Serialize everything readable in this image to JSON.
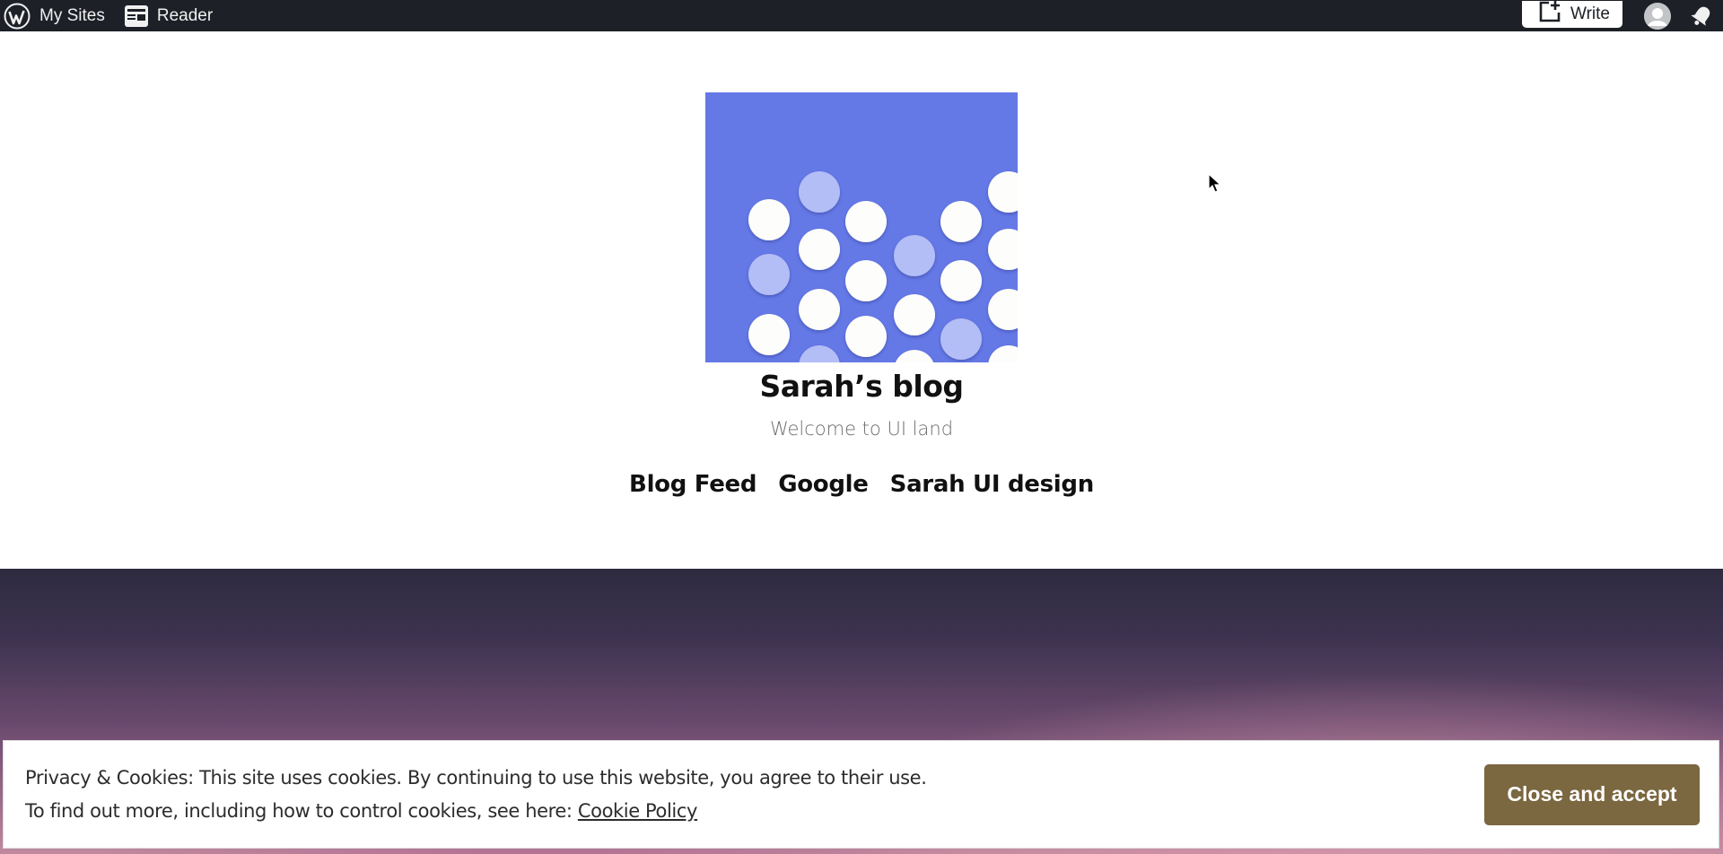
{
  "adminbar": {
    "my_sites_label": "My Sites",
    "reader_label": "Reader",
    "write_label": "Write",
    "icons": {
      "logo": "wordpress-logo-icon",
      "reader": "reader-icon",
      "write": "write-post-icon",
      "avatar": "user-avatar-icon",
      "notifications": "notifications-bell-icon"
    }
  },
  "site": {
    "title": "Sarah’s blog",
    "tagline": "Welcome to UI land",
    "logo_alt": "Site logo with white and light blue circles on a blue background",
    "logo_color": "#6478e6",
    "nav": [
      {
        "label": "Blog Feed"
      },
      {
        "label": "Google"
      },
      {
        "label": "Sarah UI design"
      }
    ]
  },
  "cookie_banner": {
    "line1": "Privacy & Cookies: This site uses cookies. By continuing to use this website, you agree to their use.",
    "line2_prefix": "To find out more, including how to control cookies, see here:",
    "policy_link": "Cookie Policy",
    "accept_label": "Close and accept",
    "accept_color": "#7b6740"
  }
}
